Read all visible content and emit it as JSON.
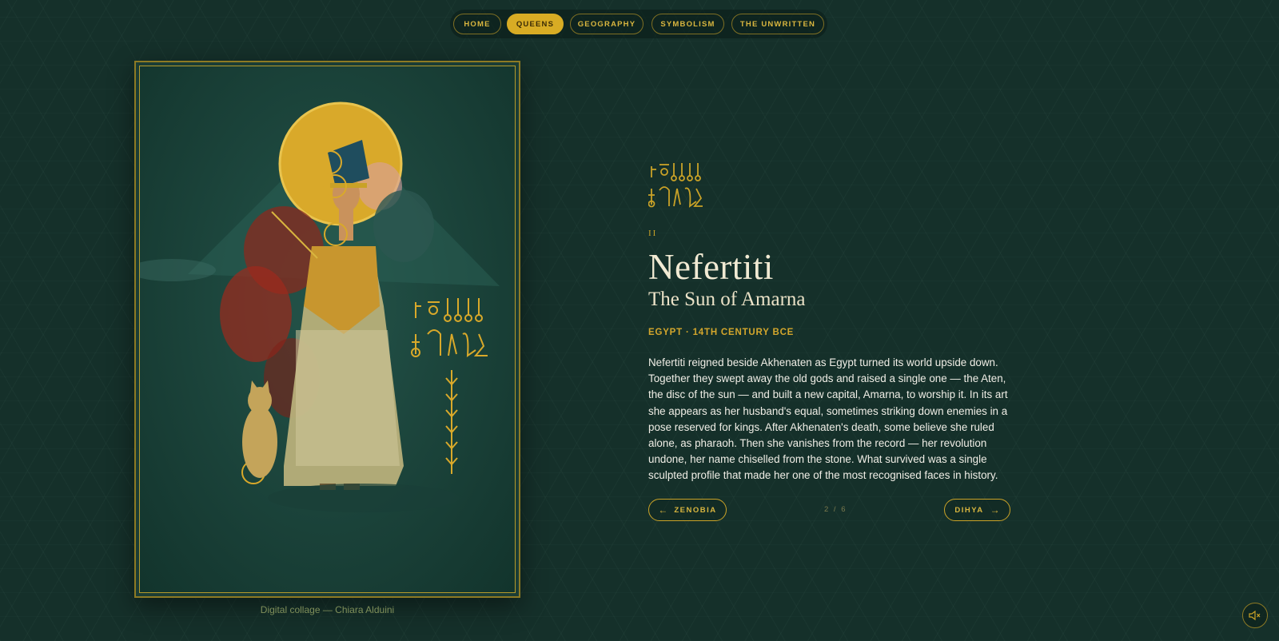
{
  "nav": {
    "items": [
      {
        "label": "HOME",
        "active": false
      },
      {
        "label": "QUEENS",
        "active": true
      },
      {
        "label": "GEOGRAPHY",
        "active": false
      },
      {
        "label": "SYMBOLISM",
        "active": false
      },
      {
        "label": "THE UNWRITTEN",
        "active": false
      }
    ]
  },
  "artwork": {
    "caption": "Digital collage — Chiara Alduini"
  },
  "queen": {
    "numeral": "II",
    "name": "Nefertiti",
    "epithet": "The Sun of Amarna",
    "meta": "EGYPT · 14TH CENTURY BCE",
    "bio": "Nefertiti reigned beside Akhenaten as Egypt turned its world upside down. Together they swept away the old gods and raised a single one — the Aten, the disc of the sun — and built a new capital, Amarna, to worship it. In its art she appears as her husband's equal, sometimes striking down enemies in a pose reserved for kings. After Akhenaten's death, some believe she ruled alone, as pharaoh. Then she vanishes from the record — her revolution undone, her name chiselled from the stone. What survived was a single sculpted profile that made her one of the most recognised faces in history."
  },
  "pager": {
    "prev_label": "ZENOBIA",
    "next_label": "DIHYA",
    "position": "2 / 6",
    "prev_arrow": "←",
    "next_arrow": "→"
  },
  "icons": {
    "sound": "speaker-muted-icon",
    "hieroglyph": "hieroglyph-cartouche-icon"
  },
  "colors": {
    "background": "#15302a",
    "gold": "#c9a227",
    "active_pill": "#d8ac24",
    "text_light": "#f1ead3"
  }
}
